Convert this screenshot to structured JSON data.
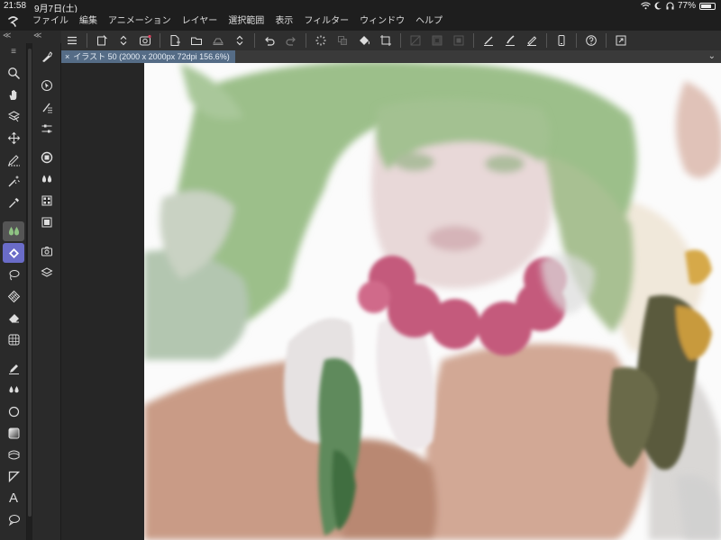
{
  "status": {
    "time": "21:58",
    "date": "9月7日(土)",
    "battery": "77%",
    "battery_level": 0.77
  },
  "menu": {
    "items": [
      "ファイル",
      "編集",
      "アニメーション",
      "レイヤー",
      "選択範囲",
      "表示",
      "フィルター",
      "ウィンドウ",
      "ヘルプ"
    ]
  },
  "toolbar_header": {
    "left_collapse": "≪",
    "right_collapse": "≪",
    "menu_glyph": "≡"
  },
  "document": {
    "close_glyph": "×",
    "tab_title": "イラスト 50 (2000 x 2000px 72dpi 156.6%)",
    "tabs_menu_glyph": "⌄"
  },
  "tools": {
    "text_tool_glyph": "A"
  },
  "colors": {
    "accent_tab": "#556c86",
    "selected_tool": "#6a6cc8",
    "hair_green": "#9cbf8a",
    "cheek_pink": "#c45a7c",
    "robe_tan": "#c8a08a"
  }
}
